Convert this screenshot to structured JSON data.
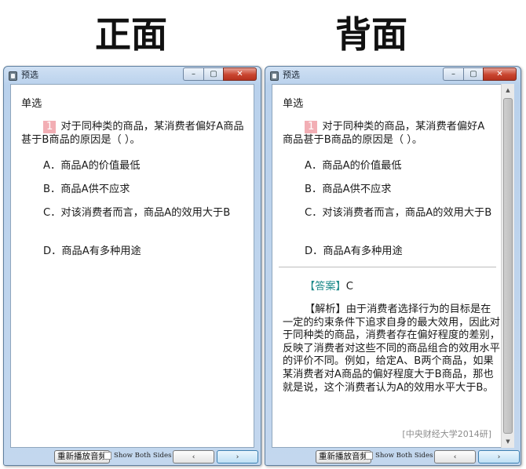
{
  "headings": {
    "front": "正面",
    "back": "背面"
  },
  "window": {
    "title": "预选",
    "controls": {
      "minimize": "–",
      "maximize": "▢",
      "close": "✕"
    },
    "replay_button": "重新播放音频",
    "show_both_sides": "Show Both Sides",
    "prev": "‹",
    "next": "›"
  },
  "question": {
    "type": "单选",
    "number": "1",
    "stem": "对于同种类的商品，某消费者偏好A商品甚于B商品的原因是（ ）。",
    "options": [
      "A．商品A的价值最低",
      "B．商品A供不应求",
      "C．对该消费者而言，商品A的效用大于B",
      "D．商品A有多种用途"
    ]
  },
  "answer": {
    "tag": "【答案】",
    "value": "C",
    "explanation": "【解析】由于消费者选择行为的目标是在一定的约束条件下追求自身的最大效用，因此对于同种类的商品，消费者存在偏好程度的差别，反映了消费者对这些不同的商品组合的效用水平的评价不同。例如，给定A、B两个商品，如果某消费者对A商品的偏好程度大于B商品，那也就是说，这个消费者认为A的效用水平大于B。",
    "source": "[中央财经大学2014研]"
  }
}
